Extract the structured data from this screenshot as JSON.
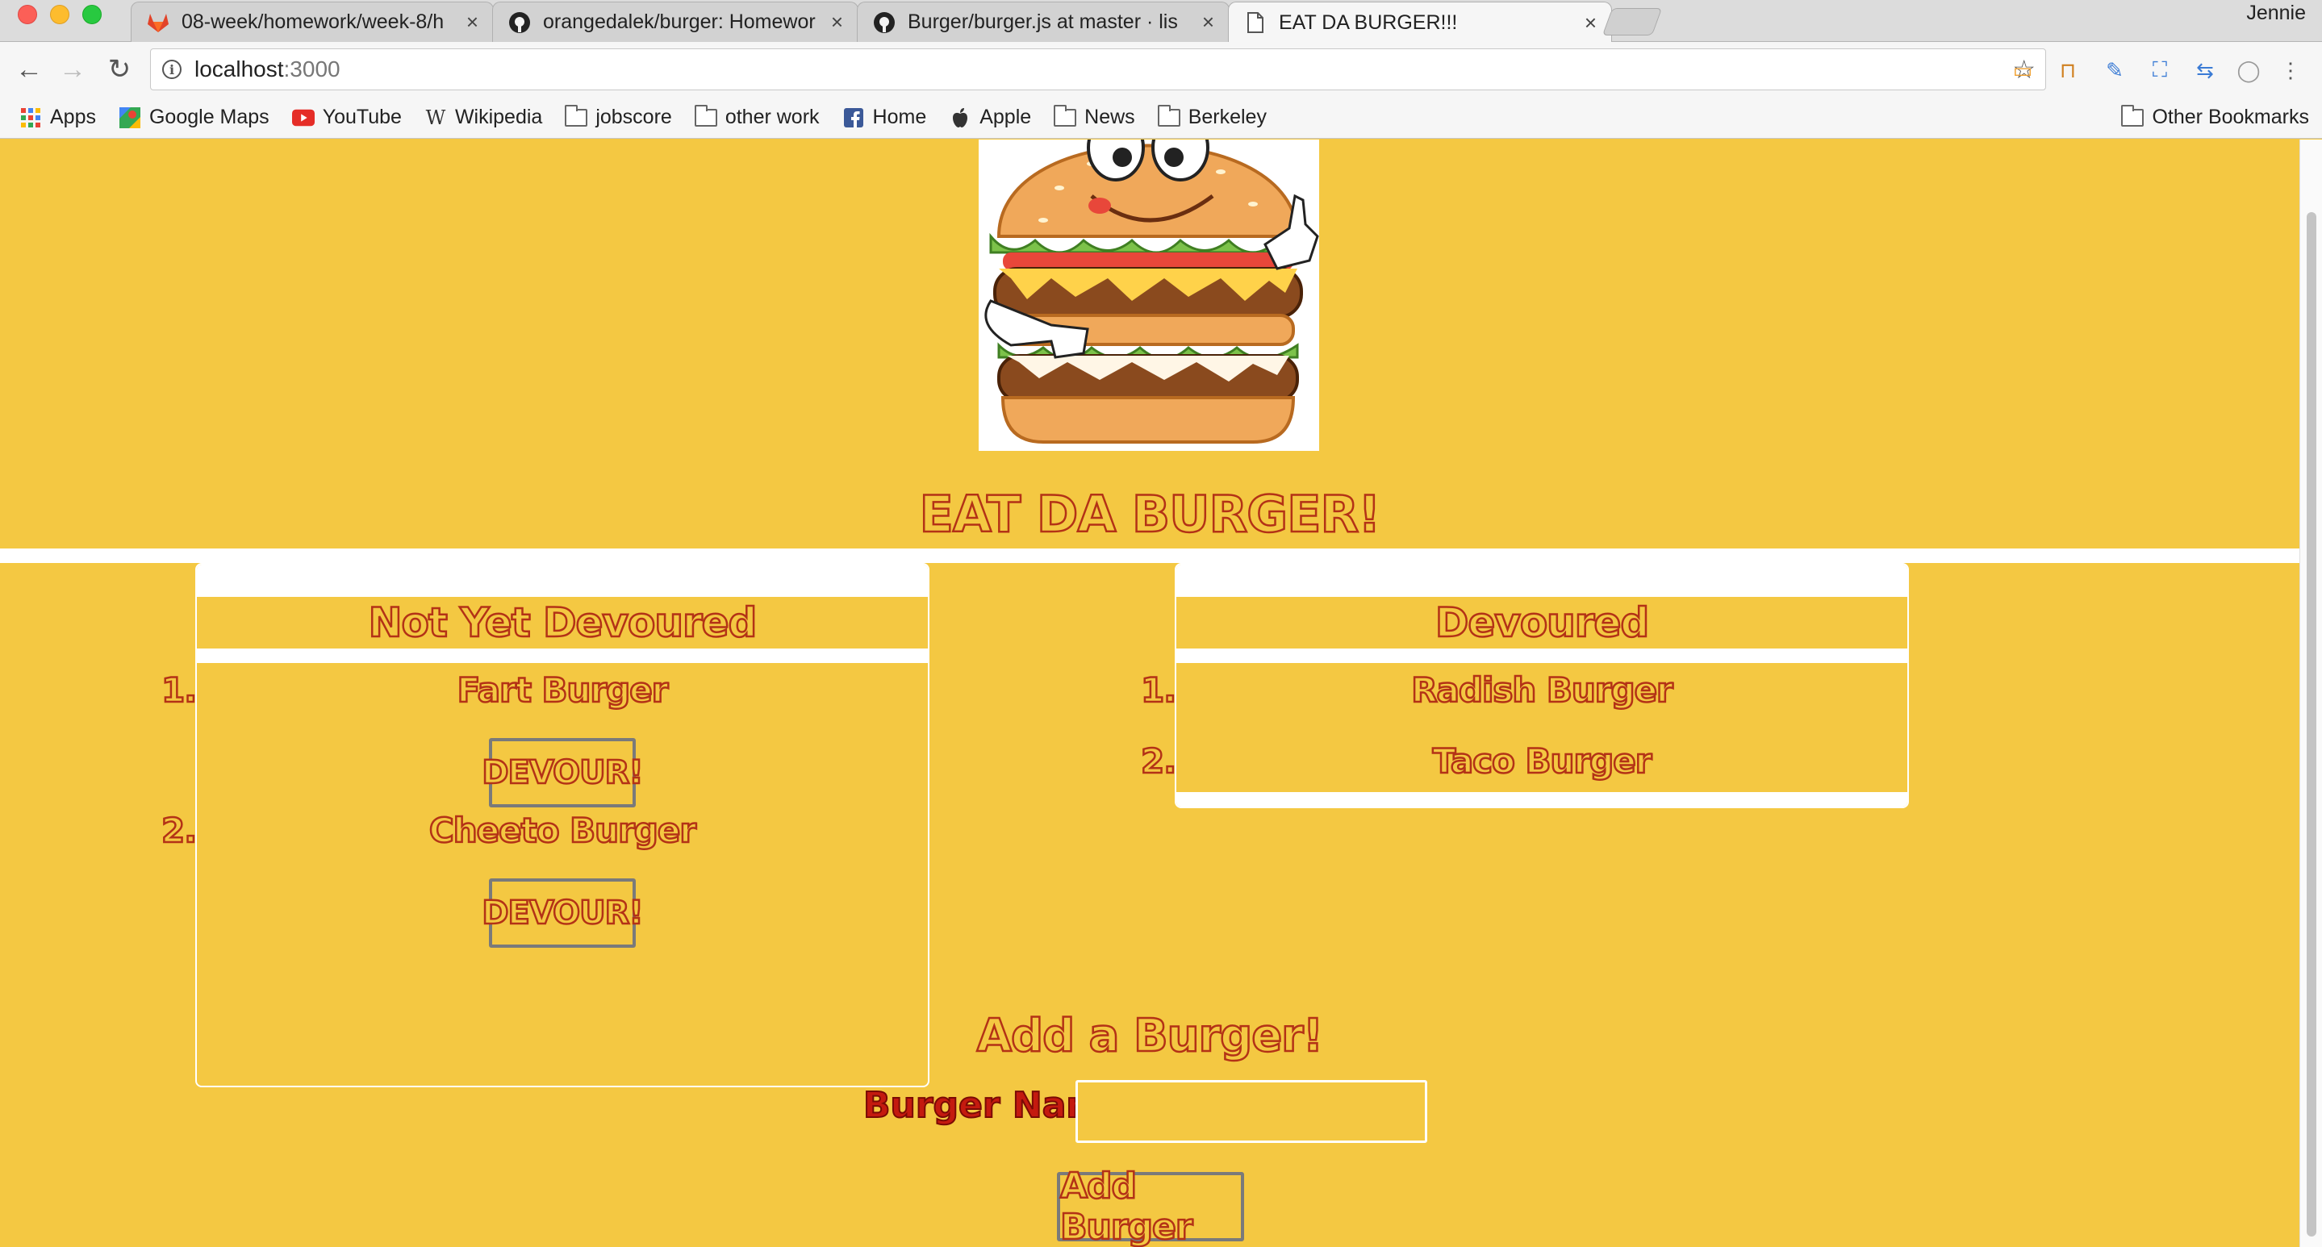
{
  "browser": {
    "user_name": "Jennie",
    "tabs": [
      {
        "title": "08-week/homework/week-8/h",
        "icon": "gitlab-icon"
      },
      {
        "title": "orangedalek/burger: Homewor",
        "icon": "github-icon"
      },
      {
        "title": "Burger/burger.js at master · lis",
        "icon": "github-icon"
      },
      {
        "title": "EAT DA BURGER!!!",
        "icon": "document-icon"
      }
    ],
    "address_host": "localhost",
    "address_port": ":3000",
    "bookmarks": [
      "Apps",
      "Google Maps",
      "YouTube",
      "Wikipedia",
      "jobscore",
      "other work",
      "Home",
      "Apple",
      "News",
      "Berkeley"
    ],
    "other_bookmarks": "Other Bookmarks"
  },
  "page": {
    "title": "EAT DA BURGER!",
    "not_devoured": {
      "heading": "Not Yet Devoured",
      "items": [
        {
          "num": "1.",
          "name": "Fart Burger",
          "button": "DEVOUR!"
        },
        {
          "num": "2.",
          "name": "Cheeto Burger",
          "button": "DEVOUR!"
        }
      ]
    },
    "devoured": {
      "heading": "Devoured",
      "items": [
        {
          "num": "1.",
          "name": "Radish Burger"
        },
        {
          "num": "2.",
          "name": "Taco Burger"
        }
      ]
    },
    "add_form": {
      "heading": "Add a Burger!",
      "name_label": "Burger Name:",
      "name_value": "",
      "submit_label": "Add Burger"
    }
  },
  "colors": {
    "page_background": "#f4c842",
    "text_outline": "#b33216",
    "label_red": "#c41a0f"
  }
}
